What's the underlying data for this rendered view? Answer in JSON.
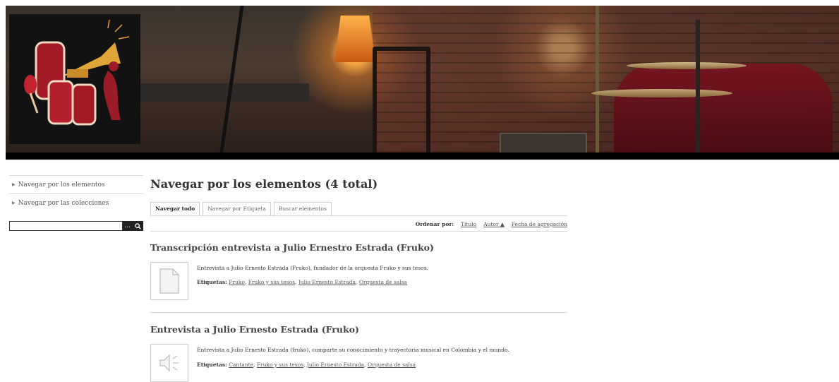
{
  "sidebar": {
    "items": [
      {
        "label": "Navegar por los elementos"
      },
      {
        "label": "Navegar por las colecciones"
      }
    ],
    "search": {
      "value": "",
      "options_label": "…"
    }
  },
  "main": {
    "title": "Navegar por los elementos (4 total)",
    "tabs": [
      {
        "label": "Navegar todo"
      },
      {
        "label": "Navegar por Etiqueta"
      },
      {
        "label": "Buscar elementos"
      }
    ],
    "sort": {
      "label": "Ordenar por:",
      "options": [
        {
          "label": "Título"
        },
        {
          "label": "Autor ▲"
        },
        {
          "label": "Fecha de agregación"
        }
      ]
    },
    "items": [
      {
        "title": "Transcripción entrevista a Julio Ernestro Estrada (Fruko)",
        "description": "Entrevista a Julio Ernesto Estrada (Fruko), fundador de la orquesta Fruko y sus tesos.",
        "tags_label": "Etiquetas:",
        "tags": [
          "Fruko",
          "Fruko y sus tesos",
          "Julio Ernesto Estrada",
          "Orquesta de salsa"
        ],
        "icon": "document-icon"
      },
      {
        "title": "Entrevista a Julio Ernesto Estrada (Fruko)",
        "description": "Entrevista a Julio Ernesto Estrada (fruko), comparte su conocimiento y trayectoria musical en Colombia y el mundo.",
        "tags_label": "Etiquetas:",
        "tags": [
          "Cantante",
          "Fruko y sus tesos",
          "Julio Ernesto Estrada",
          "Orquesta de salsa"
        ],
        "icon": "audio-icon"
      }
    ]
  },
  "header": {
    "image": "stage-banner-image",
    "logo": "music-logo-icon"
  }
}
